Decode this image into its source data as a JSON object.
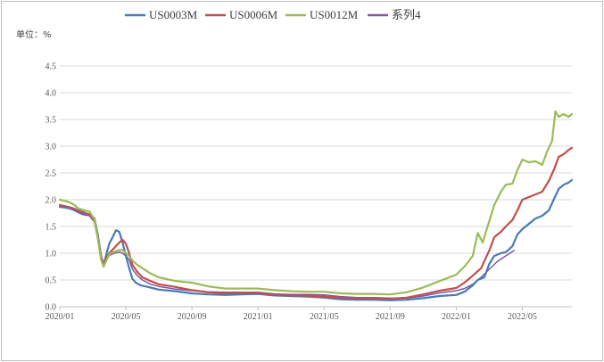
{
  "chart_data": {
    "type": "line",
    "title": "",
    "unit_label": "单位：%",
    "xlabel": "",
    "ylabel": "",
    "ylim": [
      0,
      4.5
    ],
    "yticks": [
      "0.0",
      "0.5",
      "1.0",
      "1.5",
      "2.0",
      "2.5",
      "3.0",
      "3.5",
      "4.0",
      "4.5"
    ],
    "xticks": [
      "2020/01",
      "2020/05",
      "2020/09",
      "2021/01",
      "2021/05",
      "2021/09",
      "2022/01",
      "2022/05"
    ],
    "xlim_months": [
      0,
      31
    ],
    "grid": "horizontal",
    "legend_position": "top",
    "series": [
      {
        "name": "US0003M",
        "color": "#4a7ab8",
        "points": [
          [
            0.0,
            1.87
          ],
          [
            0.3,
            1.86
          ],
          [
            0.6,
            1.84
          ],
          [
            0.9,
            1.8
          ],
          [
            1.1,
            1.77
          ],
          [
            1.4,
            1.75
          ],
          [
            1.8,
            1.73
          ],
          [
            2.1,
            1.65
          ],
          [
            2.3,
            1.35
          ],
          [
            2.5,
            0.95
          ],
          [
            2.65,
            0.78
          ],
          [
            2.8,
            0.95
          ],
          [
            3.0,
            1.18
          ],
          [
            3.2,
            1.3
          ],
          [
            3.4,
            1.43
          ],
          [
            3.6,
            1.4
          ],
          [
            3.8,
            1.2
          ],
          [
            4.0,
            0.95
          ],
          [
            4.2,
            0.72
          ],
          [
            4.4,
            0.52
          ],
          [
            4.6,
            0.45
          ],
          [
            4.9,
            0.4
          ],
          [
            5.2,
            0.38
          ],
          [
            5.6,
            0.35
          ],
          [
            6.0,
            0.32
          ],
          [
            7.0,
            0.29
          ],
          [
            8.0,
            0.25
          ],
          [
            9.0,
            0.23
          ],
          [
            10.0,
            0.22
          ],
          [
            11.0,
            0.23
          ],
          [
            12.0,
            0.24
          ],
          [
            13.0,
            0.21
          ],
          [
            14.0,
            0.2
          ],
          [
            15.0,
            0.19
          ],
          [
            16.0,
            0.17
          ],
          [
            17.0,
            0.14
          ],
          [
            18.0,
            0.13
          ],
          [
            19.0,
            0.13
          ],
          [
            20.0,
            0.12
          ],
          [
            21.0,
            0.13
          ],
          [
            22.0,
            0.16
          ],
          [
            23.0,
            0.2
          ],
          [
            24.0,
            0.22
          ],
          [
            24.5,
            0.28
          ],
          [
            25.0,
            0.4
          ],
          [
            25.3,
            0.5
          ],
          [
            25.7,
            0.55
          ],
          [
            26.0,
            0.8
          ],
          [
            26.3,
            0.95
          ],
          [
            26.7,
            1.0
          ],
          [
            27.0,
            1.02
          ],
          [
            27.4,
            1.13
          ],
          [
            27.7,
            1.35
          ],
          [
            28.0,
            1.45
          ],
          [
            28.4,
            1.55
          ],
          [
            28.8,
            1.65
          ],
          [
            29.2,
            1.7
          ],
          [
            29.6,
            1.8
          ],
          [
            29.9,
            2.0
          ],
          [
            30.2,
            2.2
          ],
          [
            30.5,
            2.28
          ],
          [
            30.8,
            2.32
          ],
          [
            31.0,
            2.37
          ]
        ]
      },
      {
        "name": "US0006M",
        "color": "#c0504d",
        "points": [
          [
            0.0,
            1.9
          ],
          [
            0.3,
            1.88
          ],
          [
            0.6,
            1.86
          ],
          [
            0.9,
            1.83
          ],
          [
            1.1,
            1.8
          ],
          [
            1.4,
            1.77
          ],
          [
            1.8,
            1.72
          ],
          [
            2.1,
            1.6
          ],
          [
            2.3,
            1.3
          ],
          [
            2.5,
            0.92
          ],
          [
            2.65,
            0.78
          ],
          [
            2.8,
            0.9
          ],
          [
            3.0,
            1.0
          ],
          [
            3.3,
            1.1
          ],
          [
            3.6,
            1.2
          ],
          [
            3.8,
            1.25
          ],
          [
            4.0,
            1.18
          ],
          [
            4.2,
            1.0
          ],
          [
            4.4,
            0.78
          ],
          [
            4.7,
            0.65
          ],
          [
            5.0,
            0.55
          ],
          [
            5.5,
            0.48
          ],
          [
            6.0,
            0.42
          ],
          [
            7.0,
            0.37
          ],
          [
            8.0,
            0.31
          ],
          [
            9.0,
            0.27
          ],
          [
            10.0,
            0.25
          ],
          [
            11.0,
            0.26
          ],
          [
            12.0,
            0.26
          ],
          [
            13.0,
            0.22
          ],
          [
            14.0,
            0.21
          ],
          [
            15.0,
            0.21
          ],
          [
            16.0,
            0.19
          ],
          [
            17.0,
            0.17
          ],
          [
            18.0,
            0.16
          ],
          [
            19.0,
            0.16
          ],
          [
            20.0,
            0.15
          ],
          [
            21.0,
            0.17
          ],
          [
            22.0,
            0.23
          ],
          [
            23.0,
            0.3
          ],
          [
            24.0,
            0.35
          ],
          [
            24.5,
            0.45
          ],
          [
            25.0,
            0.58
          ],
          [
            25.5,
            0.72
          ],
          [
            26.0,
            1.05
          ],
          [
            26.3,
            1.3
          ],
          [
            26.7,
            1.4
          ],
          [
            27.0,
            1.5
          ],
          [
            27.4,
            1.62
          ],
          [
            27.7,
            1.8
          ],
          [
            28.0,
            2.0
          ],
          [
            28.4,
            2.05
          ],
          [
            28.8,
            2.1
          ],
          [
            29.2,
            2.15
          ],
          [
            29.6,
            2.35
          ],
          [
            29.9,
            2.55
          ],
          [
            30.2,
            2.8
          ],
          [
            30.5,
            2.85
          ],
          [
            30.8,
            2.93
          ],
          [
            31.0,
            2.97
          ]
        ]
      },
      {
        "name": "US0012M",
        "color": "#9bbb59",
        "points": [
          [
            0.0,
            2.0
          ],
          [
            0.3,
            1.98
          ],
          [
            0.6,
            1.95
          ],
          [
            0.9,
            1.9
          ],
          [
            1.1,
            1.84
          ],
          [
            1.4,
            1.81
          ],
          [
            1.8,
            1.78
          ],
          [
            2.1,
            1.63
          ],
          [
            2.3,
            1.28
          ],
          [
            2.5,
            0.88
          ],
          [
            2.65,
            0.75
          ],
          [
            2.8,
            0.85
          ],
          [
            3.0,
            0.98
          ],
          [
            3.3,
            1.03
          ],
          [
            3.6,
            1.06
          ],
          [
            3.8,
            1.06
          ],
          [
            4.0,
            1.0
          ],
          [
            4.2,
            0.95
          ],
          [
            4.4,
            0.86
          ],
          [
            4.7,
            0.78
          ],
          [
            5.0,
            0.72
          ],
          [
            5.5,
            0.62
          ],
          [
            6.0,
            0.55
          ],
          [
            7.0,
            0.48
          ],
          [
            8.0,
            0.45
          ],
          [
            9.0,
            0.38
          ],
          [
            10.0,
            0.34
          ],
          [
            11.0,
            0.34
          ],
          [
            12.0,
            0.34
          ],
          [
            13.0,
            0.31
          ],
          [
            14.0,
            0.29
          ],
          [
            15.0,
            0.28
          ],
          [
            16.0,
            0.28
          ],
          [
            17.0,
            0.25
          ],
          [
            18.0,
            0.24
          ],
          [
            19.0,
            0.24
          ],
          [
            20.0,
            0.23
          ],
          [
            21.0,
            0.27
          ],
          [
            22.0,
            0.36
          ],
          [
            23.0,
            0.48
          ],
          [
            24.0,
            0.6
          ],
          [
            24.5,
            0.75
          ],
          [
            25.0,
            0.95
          ],
          [
            25.3,
            1.38
          ],
          [
            25.6,
            1.2
          ],
          [
            26.0,
            1.6
          ],
          [
            26.3,
            1.9
          ],
          [
            26.7,
            2.15
          ],
          [
            27.0,
            2.28
          ],
          [
            27.4,
            2.3
          ],
          [
            27.7,
            2.55
          ],
          [
            28.0,
            2.75
          ],
          [
            28.4,
            2.7
          ],
          [
            28.8,
            2.72
          ],
          [
            29.2,
            2.65
          ],
          [
            29.5,
            2.9
          ],
          [
            29.8,
            3.1
          ],
          [
            30.0,
            3.65
          ],
          [
            30.2,
            3.55
          ],
          [
            30.5,
            3.6
          ],
          [
            30.8,
            3.55
          ],
          [
            31.0,
            3.6
          ]
        ]
      },
      {
        "name": "系列4",
        "color": "#7e57a6",
        "points": [
          [
            0.0,
            1.86
          ],
          [
            0.3,
            1.85
          ],
          [
            0.6,
            1.83
          ],
          [
            0.9,
            1.8
          ],
          [
            1.1,
            1.76
          ],
          [
            1.4,
            1.72
          ],
          [
            1.8,
            1.7
          ],
          [
            2.1,
            1.58
          ],
          [
            2.3,
            1.28
          ],
          [
            2.5,
            0.9
          ],
          [
            2.65,
            0.76
          ],
          [
            2.8,
            0.88
          ],
          [
            3.0,
            0.96
          ],
          [
            3.3,
            1.0
          ],
          [
            3.6,
            1.02
          ],
          [
            3.8,
            1.0
          ],
          [
            4.0,
            0.95
          ],
          [
            4.2,
            0.88
          ],
          [
            4.4,
            0.7
          ],
          [
            4.7,
            0.58
          ],
          [
            5.0,
            0.5
          ],
          [
            5.5,
            0.42
          ],
          [
            6.0,
            0.38
          ],
          [
            7.0,
            0.33
          ],
          [
            8.0,
            0.3
          ],
          [
            9.0,
            0.28
          ],
          [
            10.0,
            0.27
          ],
          [
            11.0,
            0.27
          ],
          [
            12.0,
            0.27
          ],
          [
            13.0,
            0.24
          ],
          [
            14.0,
            0.23
          ],
          [
            15.0,
            0.23
          ],
          [
            16.0,
            0.22
          ],
          [
            17.0,
            0.19
          ],
          [
            18.0,
            0.17
          ],
          [
            19.0,
            0.17
          ],
          [
            20.0,
            0.16
          ],
          [
            21.0,
            0.16
          ],
          [
            22.0,
            0.2
          ],
          [
            23.0,
            0.26
          ],
          [
            24.0,
            0.3
          ],
          [
            24.5,
            0.34
          ],
          [
            25.0,
            0.42
          ],
          [
            25.5,
            0.55
          ],
          [
            26.0,
            0.7
          ],
          [
            26.5,
            0.85
          ],
          [
            27.0,
            0.95
          ],
          [
            27.5,
            1.05
          ]
        ],
        "hidden_under_others": true
      }
    ]
  }
}
